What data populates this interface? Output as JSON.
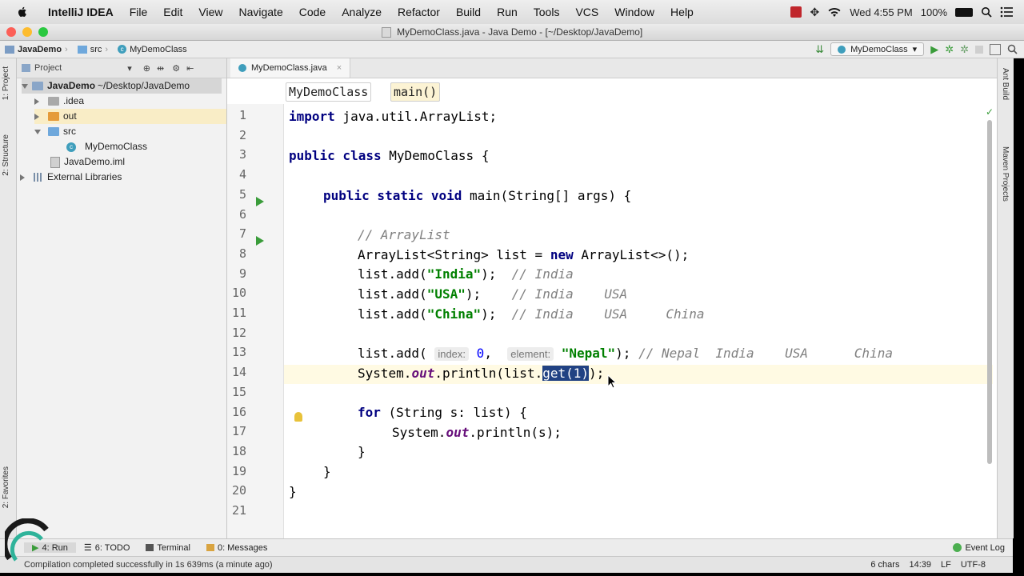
{
  "menubar": {
    "apple_icon": "apple-icon",
    "app_name": "IntelliJ IDEA",
    "items": [
      "File",
      "Edit",
      "View",
      "Navigate",
      "Code",
      "Analyze",
      "Refactor",
      "Build",
      "Run",
      "Tools",
      "VCS",
      "Window",
      "Help"
    ],
    "clock": "Wed 4:55 PM",
    "battery": "100%"
  },
  "window": {
    "title": "MyDemoClass.java - Java Demo - [~/Desktop/JavaDemo]"
  },
  "navbar": {
    "crumbs": [
      "JavaDemo",
      "src",
      "MyDemoClass"
    ],
    "run_config": "MyDemoClass"
  },
  "left_stripe": {
    "project_tab": "1: Project",
    "structure_tab": "2: Structure",
    "favorites_tab": "2: Favorites"
  },
  "right_stripe": {
    "ant_tab": "Ant Build",
    "maven_tab": "Maven Projects"
  },
  "project_panel": {
    "header": "Project",
    "tree": {
      "root_name": "JavaDemo",
      "root_path": "~/Desktop/JavaDemo",
      "idea": ".idea",
      "out": "out",
      "src": "src",
      "class_file": "MyDemoClass",
      "iml_file": "JavaDemo.iml",
      "libraries": "External Libraries"
    }
  },
  "editor": {
    "tab_label": "MyDemoClass.java",
    "breadcrumb_class": "MyDemoClass",
    "breadcrumb_method": "main()",
    "line_numbers": [
      "1",
      "2",
      "3",
      "4",
      "5",
      "6",
      "7",
      "8",
      "9",
      "10",
      "11",
      "12",
      "13",
      "14",
      "15",
      "16",
      "17",
      "18",
      "19",
      "20",
      "21"
    ],
    "lines": {
      "l1_kw": "import",
      "l1_rest": " java.util.ArrayList;",
      "l3_kw": "public class",
      "l3_rest": " MyDemoClass {",
      "l5_kw": "public static void",
      "l5_rest": " main(String[] args) {",
      "l7_cmt": "// ArrayList",
      "l8_a": "ArrayList<String> list = ",
      "l8_kw": "new",
      "l8_b": " ArrayList<>();",
      "l9_a": "list.add(",
      "l9_str": "\"India\"",
      "l9_b": ");  ",
      "l9_cmt": "// India",
      "l10_a": "list.add(",
      "l10_str": "\"USA\"",
      "l10_b": ");    ",
      "l10_cmt": "// India    USA",
      "l11_a": "list.add(",
      "l11_str": "\"China\"",
      "l11_b": ");  ",
      "l11_cmt": "// India    USA     China",
      "l13_a": "list.add( ",
      "l13_hint1": "index:",
      "l13_num": "0",
      "l13_sep": ",  ",
      "l13_hint2": "element:",
      "l13_str": "\"Nepal\"",
      "l13_b": "); ",
      "l13_cmt": "// Nepal  India    USA      China",
      "l14_a": "System.",
      "l14_it": "out",
      "l14_b": ".println(list.",
      "l14_sel": "get(1)",
      "l14_c": ");",
      "l16_kw": "for",
      "l16_rest": " (String s: list) {",
      "l17_a": "System.",
      "l17_it": "out",
      "l17_b": ".println(s);",
      "l18": "}",
      "l19": "}",
      "l20": "}"
    }
  },
  "bottom_tools": {
    "run": "4: Run",
    "todo": "6: TODO",
    "terminal": "Terminal",
    "messages": "0: Messages",
    "event_log": "Event Log"
  },
  "status": {
    "message": "Compilation completed successfully in 1s 639ms (a minute ago)",
    "chars": "6 chars",
    "position": "14:39",
    "line_sep": "LF",
    "encoding": "UTF-8"
  }
}
